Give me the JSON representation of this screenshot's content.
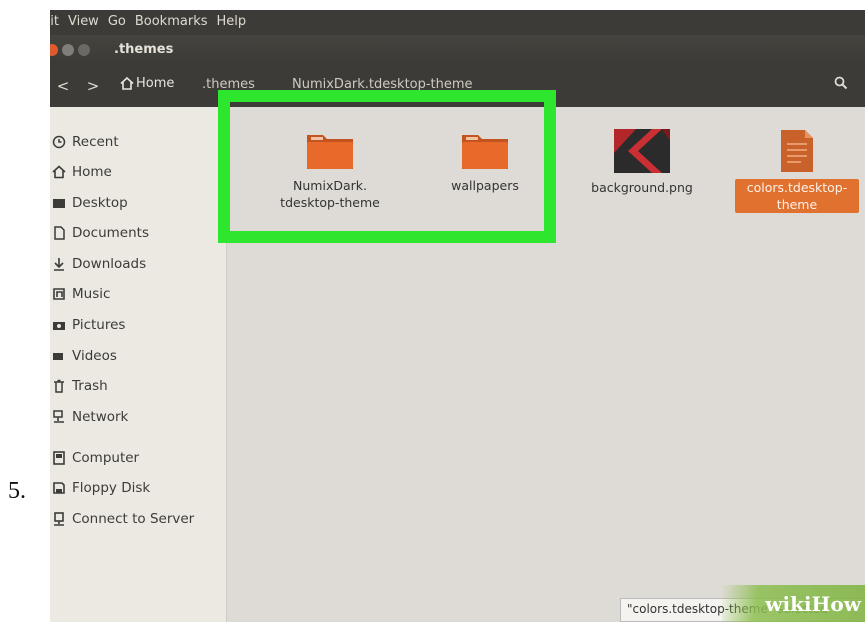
{
  "step_number": "5.",
  "menubar": {
    "items": [
      "dit",
      "View",
      "Go",
      "Bookmarks",
      "Help"
    ]
  },
  "window": {
    "title": ".themes"
  },
  "toolbar": {
    "back_glyph": "<",
    "forward_glyph": ">",
    "home_label": "Home",
    "crumb_themes": ".themes",
    "crumb_current": "NumixDark.tdesktop-theme"
  },
  "sidebar": {
    "items": [
      {
        "label": "Recent",
        "icon": "clock-icon"
      },
      {
        "label": "Home",
        "icon": "home-icon"
      },
      {
        "label": "Desktop",
        "icon": "desktop-icon"
      },
      {
        "label": "Documents",
        "icon": "document-icon"
      },
      {
        "label": "Downloads",
        "icon": "download-icon"
      },
      {
        "label": "Music",
        "icon": "music-icon"
      },
      {
        "label": "Pictures",
        "icon": "camera-icon"
      },
      {
        "label": "Videos",
        "icon": "video-icon"
      },
      {
        "label": "Trash",
        "icon": "trash-icon"
      },
      {
        "label": "Network",
        "icon": "network-icon"
      },
      {
        "label": "Computer",
        "icon": "computer-icon"
      },
      {
        "label": "Floppy Disk",
        "icon": "floppy-icon"
      },
      {
        "label": "Connect to Server",
        "icon": "server-icon"
      }
    ]
  },
  "files": [
    {
      "name_line1": "NumixDark.",
      "name_line2": "tdesktop-theme",
      "type": "folder"
    },
    {
      "name_line1": "wallpapers",
      "name_line2": "",
      "type": "folder"
    },
    {
      "name_line1": "background.png",
      "name_line2": "",
      "type": "image"
    },
    {
      "name_line1": "colors.tdesktop-",
      "name_line2": "theme",
      "type": "document",
      "selected": true
    }
  ],
  "status_bar": {
    "text": "\"colors.tdesktop-theme\" selected"
  },
  "watermark": {
    "text": "wikiHow"
  },
  "colors": {
    "highlight": "#2ee62e",
    "selection": "#e0712f",
    "folder": "#e8692a",
    "titlebar": "#3c3b37"
  }
}
